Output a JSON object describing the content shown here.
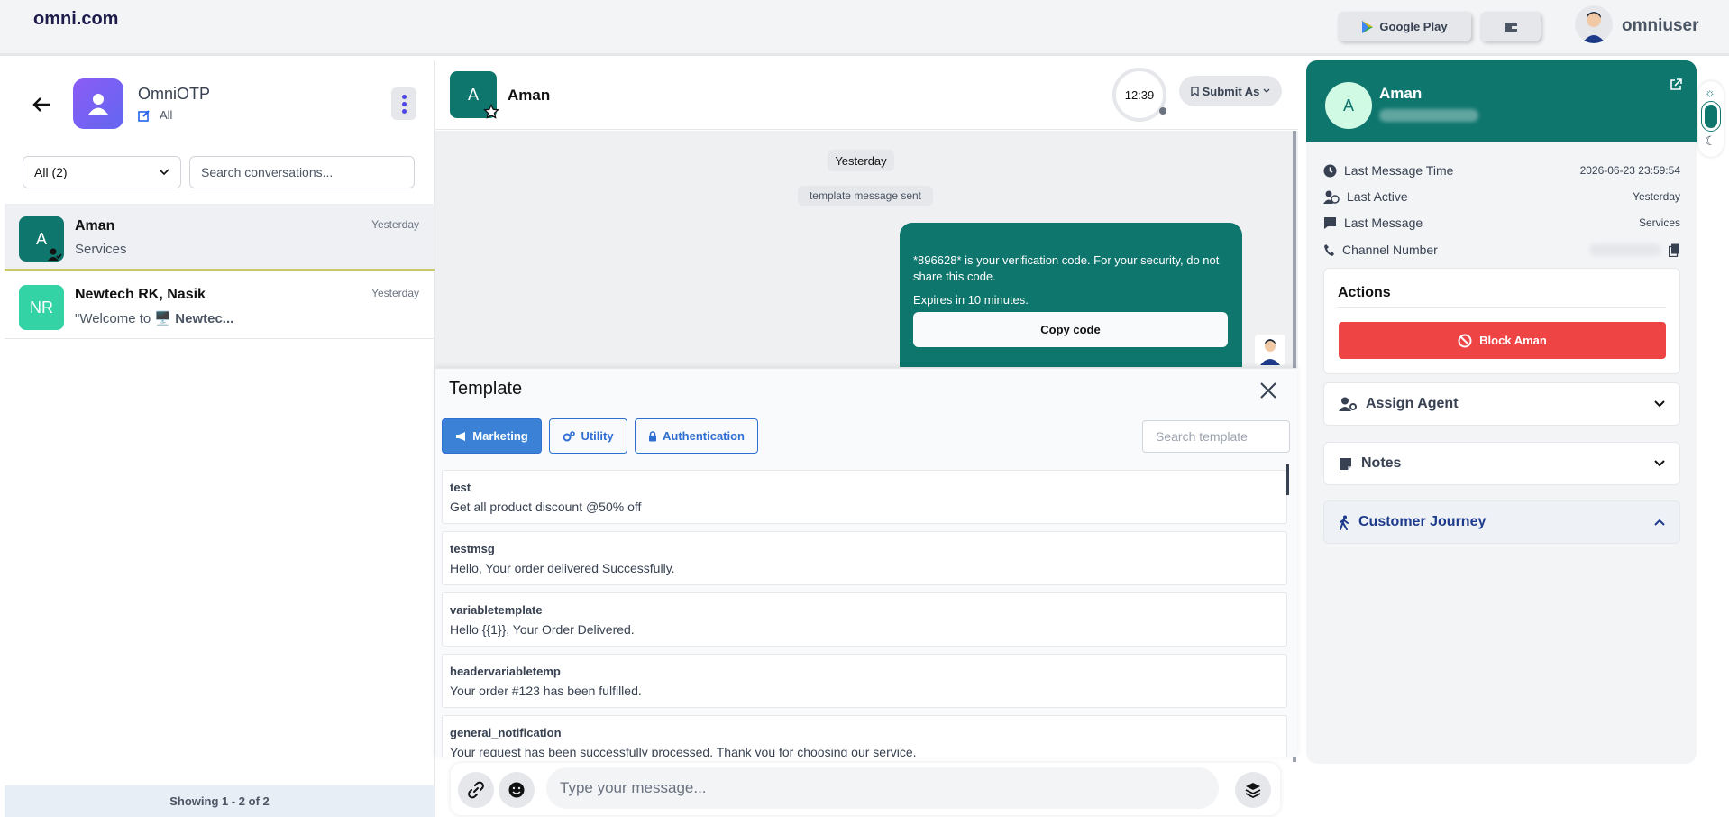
{
  "header": {
    "brand": "omni.com",
    "google_play_label": "Google Play",
    "username": "omniuser"
  },
  "sidebar": {
    "account_name": "OmniOTP",
    "account_filter": "All",
    "filter_value": "All (2)",
    "search_placeholder": "Search conversations...",
    "conversations": [
      {
        "initials": "A",
        "name": "Aman",
        "preview": "Services",
        "time": "Yesterday",
        "color": "#0f766e"
      },
      {
        "initials": "NR",
        "name": "Newtech RK, Nasik",
        "preview_prefix": "\"Welcome to ",
        "preview_bold": "Newtec...",
        "time": "Yesterday",
        "color": "#34d3a5"
      }
    ],
    "pager": "Showing 1 - 2 of 2"
  },
  "chat": {
    "initial": "A",
    "name": "Aman",
    "timer": "12:39",
    "submit_label": "Submit As",
    "day_label": "Yesterday",
    "system_message": "template message sent",
    "bubble_text": "*896628* is your verification code. For your security, do not share this code.",
    "bubble_expiry": "Expires in 10 minutes.",
    "copy_label": "Copy code",
    "composer_placeholder": "Type your message..."
  },
  "template_panel": {
    "title": "Template",
    "tabs": [
      {
        "label": "Marketing",
        "active": true
      },
      {
        "label": "Utility",
        "active": false
      },
      {
        "label": "Authentication",
        "active": false
      }
    ],
    "search_placeholder": "Search template",
    "items": [
      {
        "name": "test",
        "body": "Get all product discount @50% off"
      },
      {
        "name": "testmsg",
        "body": "Hello, Your order delivered Successfully."
      },
      {
        "name": "variabletemplate",
        "body": "Hello {{1}}, Your Order Delivered."
      },
      {
        "name": "headervariabletemp",
        "body": "Your order #123 has been fulfilled."
      },
      {
        "name": "general_notification",
        "body": "Your request has been successfully processed. Thank you for choosing our service."
      }
    ]
  },
  "customer": {
    "initial": "A",
    "name": "Aman",
    "info": [
      {
        "label": "Last Message Time",
        "value": "2026-06-23 23:59:54"
      },
      {
        "label": "Last Active",
        "value": "Yesterday"
      },
      {
        "label": "Last Message",
        "value": "Services"
      },
      {
        "label": "Channel Number",
        "value": ""
      }
    ],
    "actions_title": "Actions",
    "block_label": "Block Aman",
    "assign_agent": "Assign Agent",
    "notes": "Notes",
    "customer_journey": "Customer Journey"
  },
  "colors": {
    "accent": "#0f766e",
    "danger": "#ef4444",
    "tab_active": "#3b82d6"
  }
}
